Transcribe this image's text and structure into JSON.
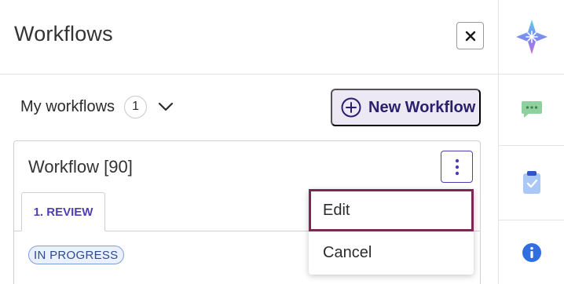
{
  "panel": {
    "title": "Workflows",
    "close_icon": "close-icon"
  },
  "filter": {
    "label": "My workflows",
    "count": "1",
    "chevron_icon": "chevron-down-icon"
  },
  "new_workflow": {
    "label": "New Workflow",
    "icon": "plus-circle-icon"
  },
  "workflow_card": {
    "title": "Workflow [90]",
    "menu_icon": "kebab-vertical-icon",
    "tabs": [
      {
        "label": "1. REVIEW"
      }
    ],
    "status": "IN PROGRESS"
  },
  "dropdown_menu": {
    "items": [
      {
        "label": "Edit"
      },
      {
        "label": "Cancel"
      }
    ]
  },
  "rail": {
    "items": [
      {
        "icon": "ai-sparkle-icon"
      },
      {
        "icon": "chat-icon"
      },
      {
        "icon": "clipboard-check-icon"
      },
      {
        "icon": "info-icon"
      }
    ]
  },
  "colors": {
    "accent": "#4f3fb5",
    "new_button_bg": "#ece9f5",
    "highlight_border": "#7a2a52",
    "status_bg": "#eaf0fc"
  }
}
